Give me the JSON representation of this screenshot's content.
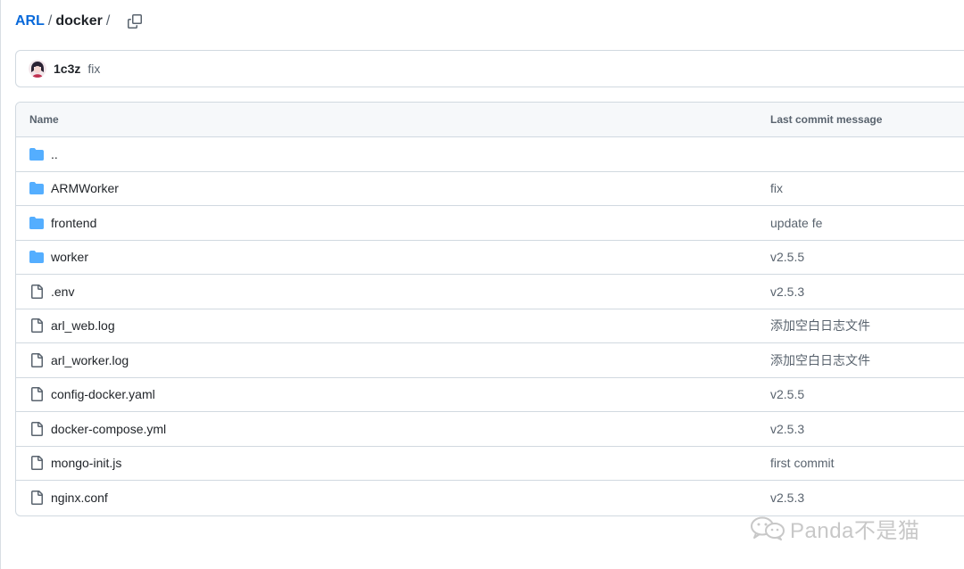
{
  "breadcrumb": {
    "repo": "ARL",
    "folder": "docker",
    "sep1": "/",
    "sep2": "/"
  },
  "latest_commit": {
    "author": "1c3z",
    "message": "fix"
  },
  "table": {
    "header_name": "Name",
    "header_message": "Last commit message",
    "rows": [
      {
        "name": "..",
        "type": "folder",
        "message": ""
      },
      {
        "name": "ARMWorker",
        "type": "folder",
        "message": "fix"
      },
      {
        "name": "frontend",
        "type": "folder",
        "message": "update fe"
      },
      {
        "name": "worker",
        "type": "folder",
        "message": "v2.5.5"
      },
      {
        "name": ".env",
        "type": "file",
        "message": "v2.5.3"
      },
      {
        "name": "arl_web.log",
        "type": "file",
        "message": "添加空白日志文件"
      },
      {
        "name": "arl_worker.log",
        "type": "file",
        "message": "添加空白日志文件"
      },
      {
        "name": "config-docker.yaml",
        "type": "file",
        "message": "v2.5.5"
      },
      {
        "name": "docker-compose.yml",
        "type": "file",
        "message": "v2.5.3"
      },
      {
        "name": "mongo-init.js",
        "type": "file",
        "message": "first commit"
      },
      {
        "name": "nginx.conf",
        "type": "file",
        "message": "v2.5.3"
      }
    ]
  },
  "watermark": {
    "text": "Panda不是猫",
    "icon": "wechat-icon"
  },
  "colors": {
    "link": "#0969da",
    "folder": "#54aeff",
    "muted": "#59636e",
    "border": "#d1d9e0"
  }
}
